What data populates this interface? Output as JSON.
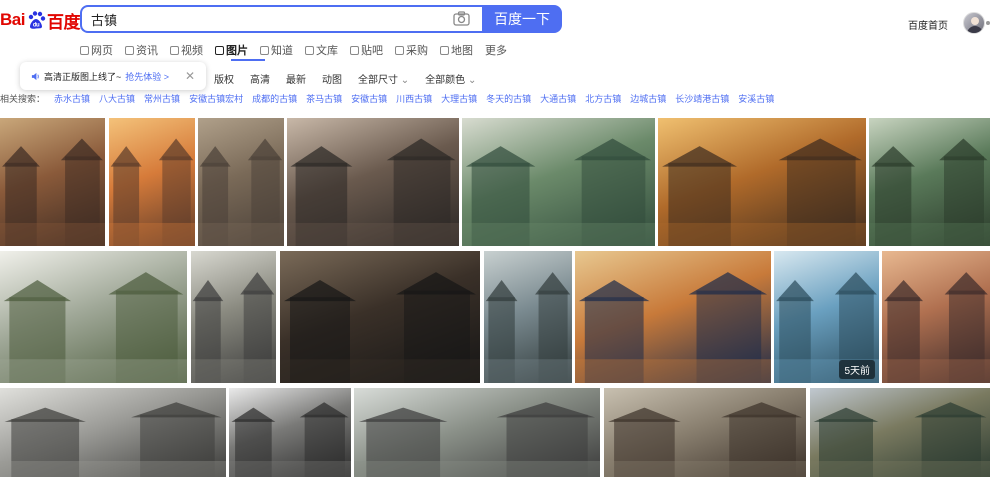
{
  "header": {
    "logo": {
      "bai": "Bai",
      "du": "du",
      "text": "百度"
    },
    "search": {
      "value": "古镇",
      "placeholder": ""
    },
    "search_button": "百度一下",
    "home_link": "百度首页"
  },
  "nav": {
    "items": [
      {
        "label": "网页",
        "icon": "search-icon"
      },
      {
        "label": "资讯",
        "icon": "news-icon"
      },
      {
        "label": "视频",
        "icon": "video-icon"
      },
      {
        "label": "图片",
        "icon": "image-icon",
        "active": true
      },
      {
        "label": "知道",
        "icon": "question-icon"
      },
      {
        "label": "文库",
        "icon": "document-icon"
      },
      {
        "label": "贴吧",
        "icon": "forum-icon"
      },
      {
        "label": "采购",
        "icon": "cart-icon"
      },
      {
        "label": "地图",
        "icon": "map-pin-icon"
      },
      {
        "label": "更多",
        "icon": ""
      }
    ]
  },
  "filters": [
    {
      "label": "版权"
    },
    {
      "label": "高清"
    },
    {
      "label": "最新"
    },
    {
      "label": "动图"
    },
    {
      "label": "全部尺寸",
      "dropdown": true
    },
    {
      "label": "全部颜色",
      "dropdown": true
    }
  ],
  "tip": {
    "text": "高清正版图上线了~",
    "link": "抢先体验 >"
  },
  "related": {
    "label": "相关搜索：",
    "items": [
      "赤水古镇",
      "八大古镇",
      "常州古镇",
      "安徽古镇宏村",
      "成都的古镇",
      "茶马古镇",
      "安徽古镇",
      "川西古镇",
      "大理古镇",
      "冬天的古镇",
      "大通古镇",
      "北方古镇",
      "边城古镇",
      "长沙靖港古镇",
      "安溪古镇"
    ]
  },
  "images": {
    "row1": [
      "ancient-street-red-lanterns",
      "sunset-old-town",
      "wet-stone-alley",
      "alley-with-lanterns",
      "riverside-stilt-houses",
      "gate-night-street",
      "canal-boat-village"
    ],
    "row2": [
      "white-wall-village-garden",
      "narrow-alley-red-umbrella",
      "dark-lantern-street",
      "water-town-bridge",
      "stone-bridge-dusk-reflection",
      "woman-blue-dress-canal",
      "canal-houses-sunset"
    ],
    "row3": [
      "huizhou-white-houses",
      "black-tile-roofs",
      "misty-street",
      "old-town-rooftops",
      "cliffside-houses",
      "lantern-shop-blue-sky"
    ],
    "badge": "5天前"
  }
}
